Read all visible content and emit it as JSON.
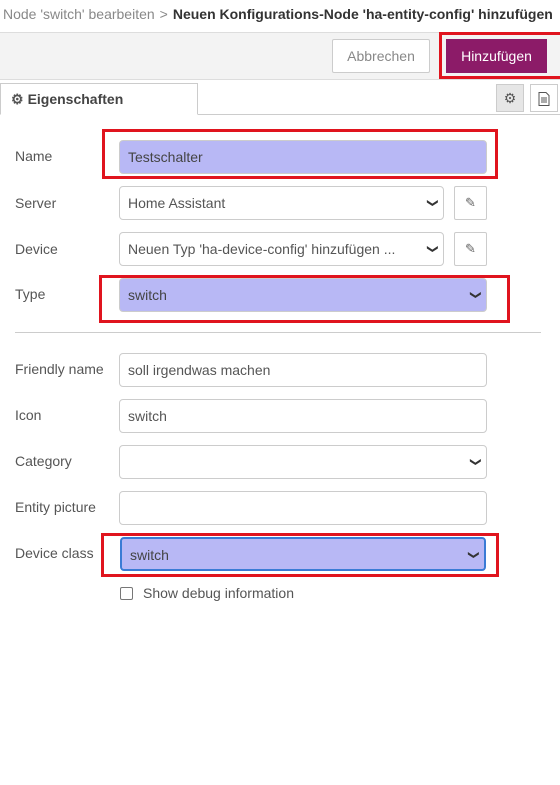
{
  "breadcrumb": {
    "parent": "Node 'switch' bearbeiten",
    "separator": ">",
    "current": "Neuen Konfigurations-Node 'ha-entity-config' hinzufügen"
  },
  "toolbar": {
    "cancel_label": "Abbrechen",
    "add_label": "Hinzufügen"
  },
  "tabs": {
    "properties_label": "Eigenschaften",
    "icons": [
      "gear-icon",
      "document-icon"
    ]
  },
  "form": {
    "name": {
      "label": "Name",
      "value": "Testschalter"
    },
    "server": {
      "label": "Server",
      "value": "Home Assistant"
    },
    "device": {
      "label": "Device",
      "value": "Neuen Typ 'ha-device-config' hinzufügen ..."
    },
    "type": {
      "label": "Type",
      "value": "switch"
    },
    "friendly_name": {
      "label": "Friendly name",
      "value": "soll irgendwas machen"
    },
    "icon": {
      "label": "Icon",
      "value": "switch"
    },
    "category": {
      "label": "Category",
      "value": ""
    },
    "entity_picture": {
      "label": "Entity picture",
      "value": ""
    },
    "device_class": {
      "label": "Device class",
      "value": "switch"
    },
    "debug": {
      "label": "Show debug information",
      "checked": false
    }
  },
  "colors": {
    "accent": "#8c1b68",
    "highlight_border": "#e0141e",
    "highlight_fill": "#b8b8f5"
  }
}
